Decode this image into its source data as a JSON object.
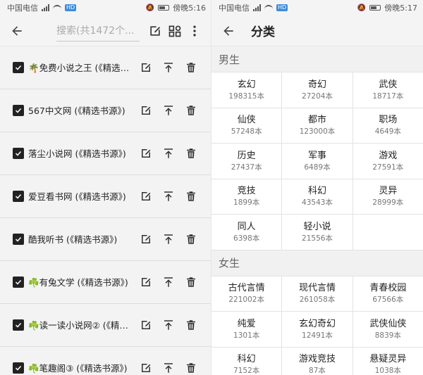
{
  "left": {
    "status": {
      "carrier": "中国电信",
      "network": "HD",
      "time": "傍晚5:16"
    },
    "search": {
      "placeholder": "搜索(共1472个..."
    },
    "sources": [
      {
        "label": "🌴免费小说之王 (《精选书..."
      },
      {
        "label": "567中文网 (《精选书源》)"
      },
      {
        "label": "落尘小说网 (《精选书源》)"
      },
      {
        "label": "爱豆看书网 (《精选书源》)"
      },
      {
        "label": "酷我听书 (《精选书源》)"
      },
      {
        "label": "☘️有兔文学 (《精选书源》)"
      },
      {
        "label": "☘️读一读小说网② (《精选..."
      },
      {
        "label": "☘️笔趣阁③ (《精选书源》)"
      }
    ]
  },
  "right": {
    "status": {
      "carrier": "中国电信",
      "network": "HD",
      "time": "傍晚5:17"
    },
    "title": "分类",
    "male": {
      "heading": "男生",
      "items": [
        {
          "name": "玄幻",
          "count": "198315本"
        },
        {
          "name": "奇幻",
          "count": "27204本"
        },
        {
          "name": "武侠",
          "count": "18717本"
        },
        {
          "name": "仙侠",
          "count": "57248本"
        },
        {
          "name": "都市",
          "count": "123000本"
        },
        {
          "name": "职场",
          "count": "4649本"
        },
        {
          "name": "历史",
          "count": "27437本"
        },
        {
          "name": "军事",
          "count": "6489本"
        },
        {
          "name": "游戏",
          "count": "27591本"
        },
        {
          "name": "竞技",
          "count": "1899本"
        },
        {
          "name": "科幻",
          "count": "43543本"
        },
        {
          "name": "灵异",
          "count": "28999本"
        },
        {
          "name": "同人",
          "count": "6398本"
        },
        {
          "name": "轻小说",
          "count": "21556本"
        }
      ]
    },
    "female": {
      "heading": "女生",
      "items": [
        {
          "name": "古代言情",
          "count": "221002本"
        },
        {
          "name": "现代言情",
          "count": "261058本"
        },
        {
          "name": "青春校园",
          "count": "67566本"
        },
        {
          "name": "纯爱",
          "count": "1301本"
        },
        {
          "name": "玄幻奇幻",
          "count": "12491本"
        },
        {
          "name": "武侠仙侠",
          "count": "8839本"
        },
        {
          "name": "科幻",
          "count": "7152本"
        },
        {
          "name": "游戏竞技",
          "count": "87本"
        },
        {
          "name": "悬疑灵异",
          "count": "1038本"
        }
      ]
    }
  }
}
